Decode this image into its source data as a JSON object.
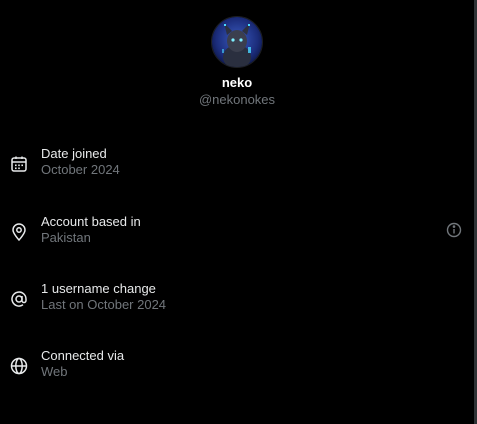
{
  "profile": {
    "name": "neko",
    "handle": "@nekonokes"
  },
  "details": [
    {
      "icon": "calendar-icon",
      "title": "Date joined",
      "subtitle": "October 2024"
    },
    {
      "icon": "location-pin-icon",
      "title": "Account based in",
      "subtitle": "Pakistan"
    },
    {
      "icon": "at-sign-icon",
      "title": "1 username change",
      "subtitle": "Last on October 2024"
    },
    {
      "icon": "globe-icon",
      "title": "Connected via",
      "subtitle": "Web"
    }
  ],
  "colors": {
    "background": "#000000",
    "primary_text": "#e7e9ea",
    "secondary_text": "#71767b",
    "avatar_bg": "#1a2a6b"
  }
}
